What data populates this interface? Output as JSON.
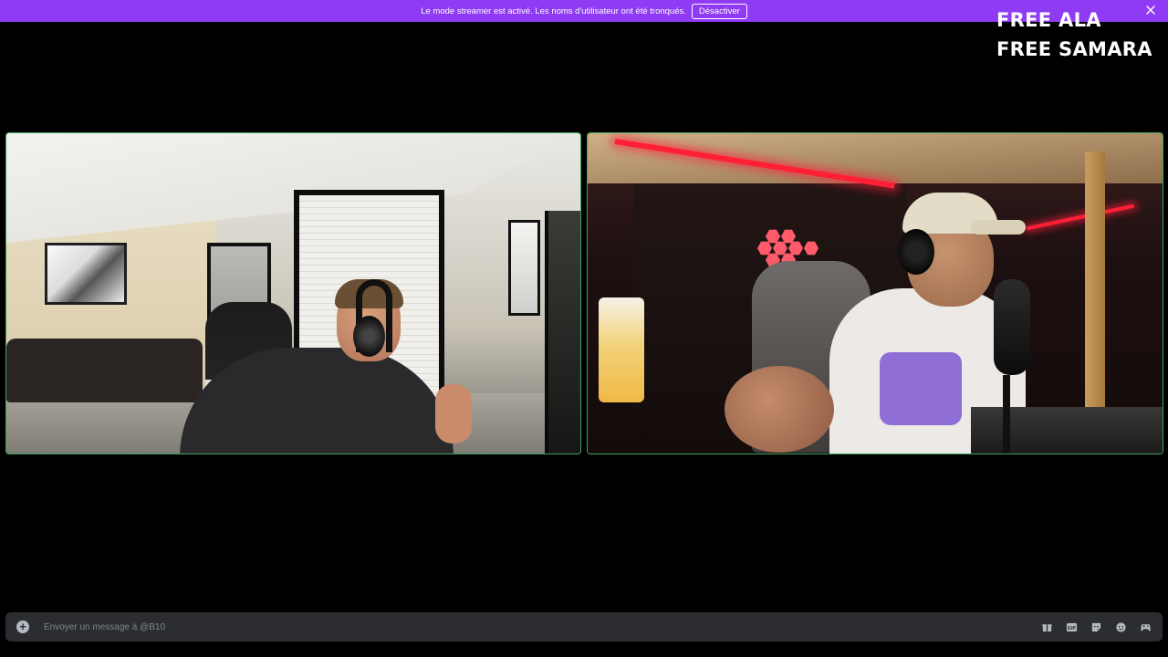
{
  "banner": {
    "message": "Le mode streamer est activé. Les noms d'utilisateur ont été tronqués.",
    "action_label": "Désactiver",
    "color": "#8f3bf3"
  },
  "overlay": {
    "line1": "FREE ALA",
    "line2": "FREE SAMARA"
  },
  "call": {
    "tile_border_color": "#3ba55c",
    "tiles": [
      "left-participant-video",
      "right-participant-video"
    ]
  },
  "composer": {
    "placeholder": "Envoyer un message à @B10",
    "value": "",
    "icons": [
      "add-icon",
      "gift-icon",
      "gif-icon",
      "sticker-icon",
      "emoji-icon",
      "activity-icon"
    ]
  }
}
